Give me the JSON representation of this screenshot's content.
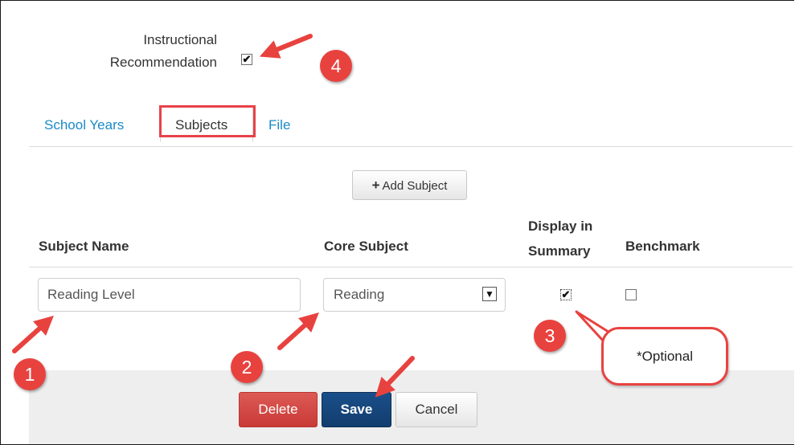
{
  "instructional_recommendation": {
    "label_line1": "Instructional",
    "label_line2": "Recommendation",
    "checked": true,
    "check_glyph": "✔"
  },
  "tabs": [
    {
      "label": "School Years",
      "active": false
    },
    {
      "label": "Subjects",
      "active": true
    },
    {
      "label": "File",
      "active": false
    }
  ],
  "add_subject": {
    "icon": "plus-icon",
    "plus": "+",
    "label": "Add Subject"
  },
  "table": {
    "headers": {
      "subject_name": "Subject Name",
      "core_subject": "Core Subject",
      "display_line1": "Display in",
      "display_line2": "Summary",
      "benchmark": "Benchmark"
    },
    "row": {
      "subject_name": "Reading Level",
      "core_subject": "Reading",
      "display_in_summary": true,
      "benchmark": false,
      "check_glyph": "✔",
      "dropdown_glyph": "▼"
    }
  },
  "actions": {
    "delete": "Delete",
    "save": "Save",
    "cancel": "Cancel"
  },
  "annotations": {
    "badges": [
      "1",
      "2",
      "3",
      "4"
    ],
    "callout": "*Optional",
    "color": "#e8423f"
  },
  "colors": {
    "link": "#1a8ac8",
    "save": "#17467c",
    "delete": "#d04a46"
  }
}
